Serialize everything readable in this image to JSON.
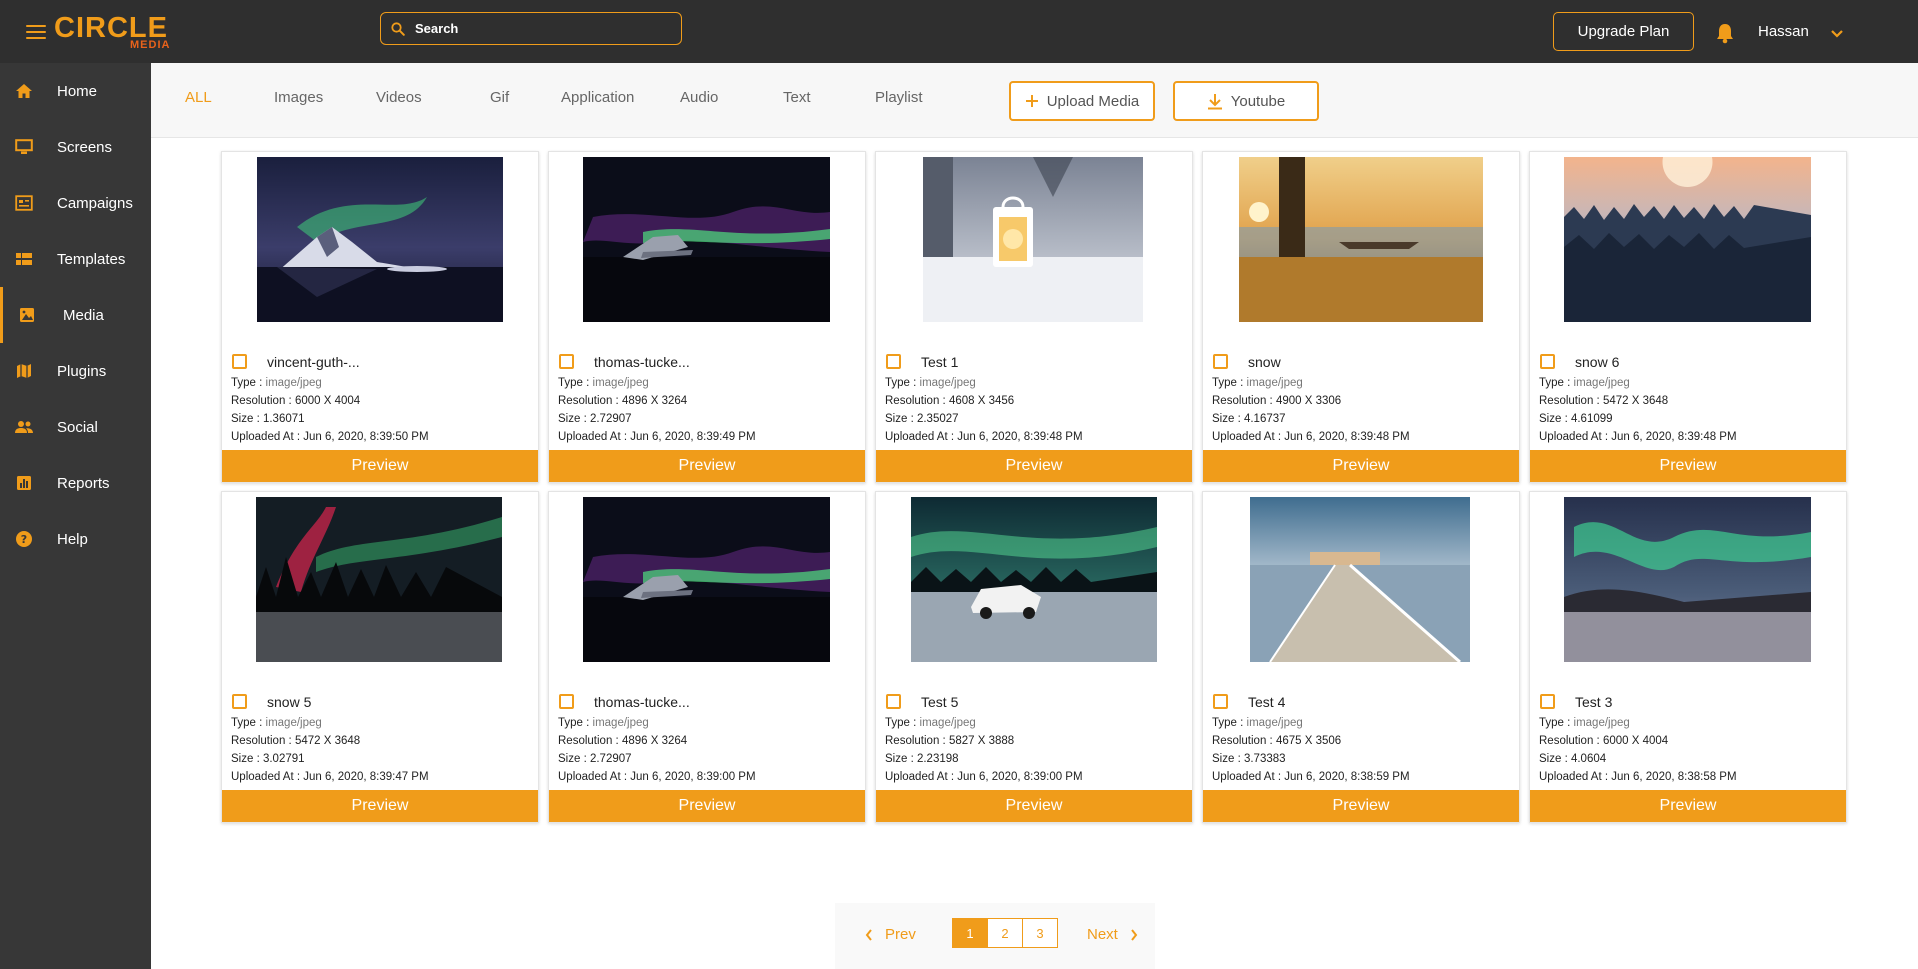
{
  "brand": {
    "logo_main": "CIRCLE",
    "logo_sub": "MEDIA"
  },
  "topbar": {
    "search_placeholder": "Search",
    "upgrade_label": "Upgrade Plan",
    "username": "Hassan"
  },
  "sidebar": {
    "items": [
      {
        "label": "Home",
        "icon": "home-icon"
      },
      {
        "label": "Screens",
        "icon": "monitor-icon"
      },
      {
        "label": "Campaigns",
        "icon": "campaign-icon"
      },
      {
        "label": "Templates",
        "icon": "grid-template-icon"
      },
      {
        "label": "Media",
        "icon": "image-icon",
        "active": true
      },
      {
        "label": "Plugins",
        "icon": "map-icon"
      },
      {
        "label": "Social",
        "icon": "people-icon"
      },
      {
        "label": "Reports",
        "icon": "bar-chart-icon"
      },
      {
        "label": "Help",
        "icon": "help-icon"
      }
    ]
  },
  "filters": {
    "tabs": [
      "ALL",
      "Images",
      "Videos",
      "Gif",
      "Application",
      "Audio",
      "Text",
      "Playlist"
    ],
    "active": "ALL",
    "upload_label": "Upload Media",
    "youtube_label": "Youtube"
  },
  "labels": {
    "type": "Type : ",
    "resolution": "Resolution : ",
    "size": "Size : ",
    "uploaded": "Uploaded At : ",
    "preview": "Preview"
  },
  "media": [
    {
      "title": "vincent-guth-...",
      "type": "image/jpeg",
      "resolution": "6000 X 4004",
      "size": "1.36071",
      "uploaded": "Jun 6, 2020, 8:39:50 PM",
      "scene": "aurora-lake-mountain"
    },
    {
      "title": "thomas-tucke...",
      "type": "image/jpeg",
      "resolution": "4896 X 3264",
      "size": "2.72907",
      "uploaded": "Jun 6, 2020, 8:39:49 PM",
      "scene": "aurora-plane-wreck"
    },
    {
      "title": "Test 1",
      "type": "image/jpeg",
      "resolution": "4608 X 3456",
      "size": "2.35027",
      "uploaded": "Jun 6, 2020, 8:39:48 PM",
      "scene": "snow-lantern"
    },
    {
      "title": "snow",
      "type": "image/jpeg",
      "resolution": "4900 X 3306",
      "size": "4.16737",
      "uploaded": "Jun 6, 2020, 8:39:48 PM",
      "scene": "autumn-lake-tree"
    },
    {
      "title": "snow 6",
      "type": "image/jpeg",
      "resolution": "5472 X 3648",
      "size": "4.61099",
      "uploaded": "Jun 6, 2020, 8:39:48 PM",
      "scene": "snowy-forest-sunrise"
    },
    {
      "title": "snow 5",
      "type": "image/jpeg",
      "resolution": "5472 X 3648",
      "size": "3.02791",
      "uploaded": "Jun 6, 2020, 8:39:47 PM",
      "scene": "aurora-red-forest"
    },
    {
      "title": "thomas-tucke...",
      "type": "image/jpeg",
      "resolution": "4896 X 3264",
      "size": "2.72907",
      "uploaded": "Jun 6, 2020, 8:39:00 PM",
      "scene": "aurora-plane-wreck"
    },
    {
      "title": "Test 5",
      "type": "image/jpeg",
      "resolution": "5827 X 3888",
      "size": "2.23198",
      "uploaded": "Jun 6, 2020, 8:39:00 PM",
      "scene": "aurora-car-snow"
    },
    {
      "title": "Test 4",
      "type": "image/jpeg",
      "resolution": "4675 X 3506",
      "size": "3.73383",
      "uploaded": "Jun 6, 2020, 8:38:59 PM",
      "scene": "pier-winter"
    },
    {
      "title": "Test 3",
      "type": "image/jpeg",
      "resolution": "6000 X 4004",
      "size": "4.0604",
      "uploaded": "Jun 6, 2020, 8:38:58 PM",
      "scene": "aurora-green-hills"
    }
  ],
  "pagination": {
    "prev_label": "Prev",
    "next_label": "Next",
    "pages": [
      "1",
      "2",
      "3"
    ],
    "current": "1"
  },
  "colors": {
    "accent": "#f09c1a",
    "topbar": "#2f2f2f",
    "sidebar": "#373737"
  }
}
